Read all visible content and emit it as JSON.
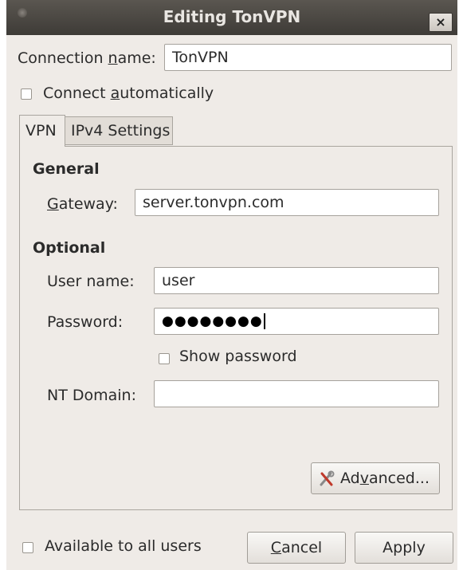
{
  "window": {
    "title": "Editing TonVPN",
    "close_glyph": "×"
  },
  "connection": {
    "name_label_pre": "Connection ",
    "name_label_mnemonic": "n",
    "name_label_post": "ame:",
    "name_value": "TonVPN"
  },
  "auto_connect": {
    "label_pre": "Connect ",
    "label_mnemonic": "a",
    "label_post": "utomatically",
    "checked": false
  },
  "tabs": [
    {
      "label": "VPN",
      "active": true
    },
    {
      "label": "IPv4 Settings",
      "active": false
    }
  ],
  "general": {
    "heading": "General",
    "gateway_label_mnemonic": "G",
    "gateway_label_post": "ateway:",
    "gateway_value": "server.tonvpn.com"
  },
  "optional": {
    "heading": "Optional",
    "username_label": "User name:",
    "username_value": "user",
    "password_label": "Password:",
    "password_masked": "●●●●●●●●",
    "show_password_label": "Show password",
    "nt_domain_label": "NT Domain:",
    "nt_domain_value": ""
  },
  "advanced_button": {
    "label_pre": "Ad",
    "label_mnemonic": "v",
    "label_post": "anced...",
    "icon": "wrench-screwdriver-icon"
  },
  "footer": {
    "available_label": "Available to all users",
    "available_checked": false,
    "cancel_mnemonic": "C",
    "cancel_post": "ancel",
    "apply_label": "Apply"
  }
}
